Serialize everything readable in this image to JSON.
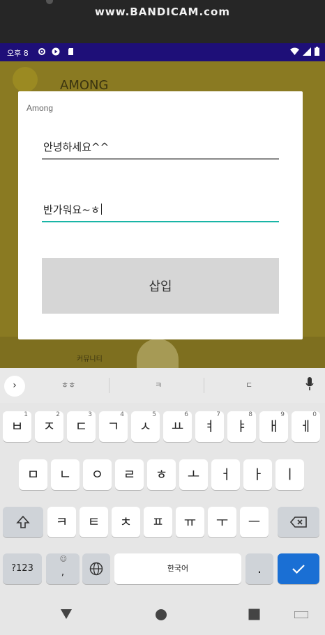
{
  "watermark": "www.BANDICAM.com",
  "status_bar": {
    "time": "오후 8",
    "icons": [
      "gear-icon",
      "play-icon",
      "sd-card-icon"
    ],
    "right_icons": [
      "wifi-icon",
      "signal-icon",
      "battery-icon"
    ]
  },
  "app_background": {
    "title": "AMONG",
    "nav_label": "커뮤니티"
  },
  "dialog": {
    "title": "Among",
    "field1_value": "안녕하세요^^",
    "field2_value": "반가워요~ㅎ",
    "insert_label": "삽입"
  },
  "keyboard": {
    "suggestions": [
      "ㅎㅎ",
      "ㅋ",
      "ㄷ"
    ],
    "row1": [
      {
        "k": "ㅂ",
        "h": "1"
      },
      {
        "k": "ㅈ",
        "h": "2"
      },
      {
        "k": "ㄷ",
        "h": "3"
      },
      {
        "k": "ㄱ",
        "h": "4"
      },
      {
        "k": "ㅅ",
        "h": "5"
      },
      {
        "k": "ㅛ",
        "h": "6"
      },
      {
        "k": "ㅕ",
        "h": "7"
      },
      {
        "k": "ㅑ",
        "h": "8"
      },
      {
        "k": "ㅐ",
        "h": "9"
      },
      {
        "k": "ㅔ",
        "h": "0"
      }
    ],
    "row2": [
      "ㅁ",
      "ㄴ",
      "ㅇ",
      "ㄹ",
      "ㅎ",
      "ㅗ",
      "ㅓ",
      "ㅏ",
      "ㅣ"
    ],
    "row3": [
      "ㅋ",
      "ㅌ",
      "ㅊ",
      "ㅍ",
      "ㅠ",
      "ㅜ",
      "ㅡ"
    ],
    "symbols_label": "?123",
    "comma_label": ",",
    "comma_hint": "☺",
    "space_label": "한국어",
    "period_label": "."
  }
}
